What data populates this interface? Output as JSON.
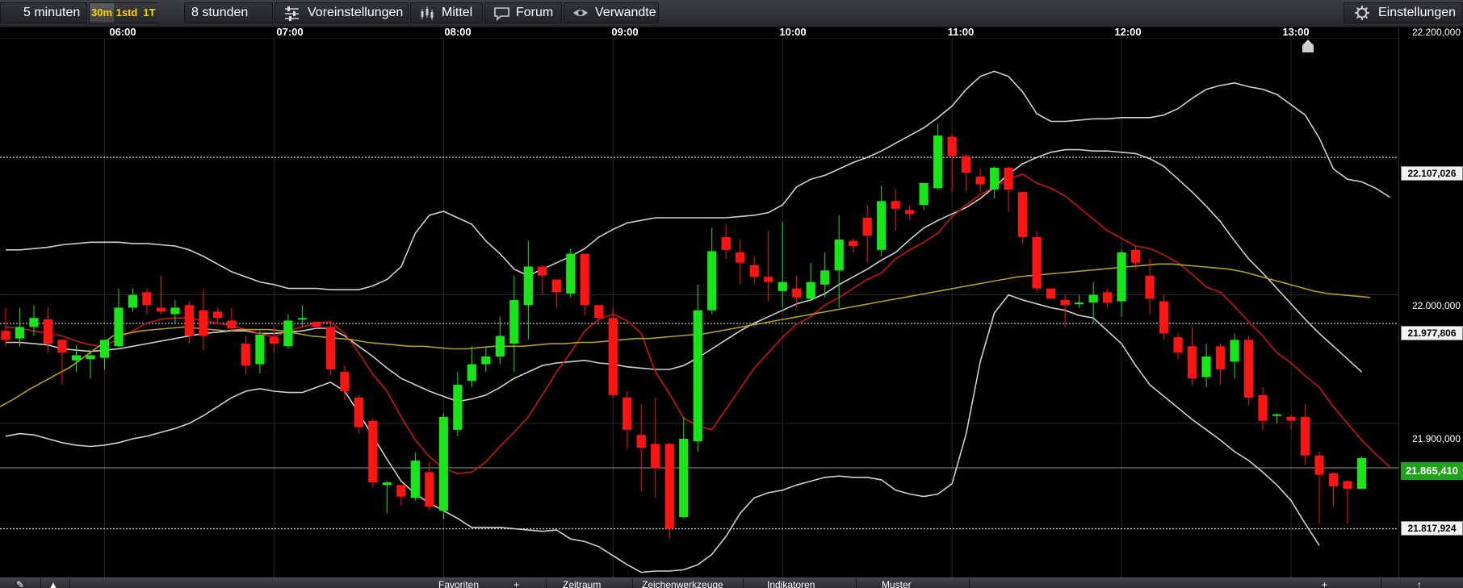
{
  "toolbar": {
    "interval": "5 minuten",
    "timeframes": [
      "30m",
      "1std",
      "1T"
    ],
    "period": "8 stunden",
    "presets": "Voreinstellungen",
    "average": "Mittel",
    "forum": "Forum",
    "related": "Verwandte",
    "settings": "Einstellungen"
  },
  "icons": {
    "presets": "sliders-icon",
    "average": "candles-icon",
    "forum": "chat-bubble-icon",
    "related": "eye-icon",
    "settings": "gear-icon"
  },
  "bottom_bar": {
    "tabs": [
      "Favoriten",
      "Zeitraum",
      "Zeichenwerkzeuge",
      "Indikatoren",
      "Muster"
    ]
  },
  "colors": {
    "bull": "#19e619",
    "bear": "#ff1414",
    "bollinger": "#d0d0d0",
    "ma_short": "#cc1414",
    "ma_long": "#b3a21e",
    "current_price": "#1fa319"
  },
  "chart_data": {
    "type": "candlestick",
    "x_ticks": [
      "06:00",
      "07:00",
      "08:00",
      "09:00",
      "10:00",
      "11:00",
      "12:00",
      "13:00"
    ],
    "y_ticks": [
      "22.200,000",
      "22.000,000",
      "21.900,000"
    ],
    "price_markers": [
      "22.107,026",
      "21.977,806",
      "21.817,924"
    ],
    "current_price": "21.865,410",
    "ylim": [
      21780,
      22200
    ],
    "xlim": [
      "05:23",
      "13:38"
    ],
    "candle_interval_minutes": 5,
    "first_candle_time": "05:25",
    "candles": [
      [
        21972,
        21965,
        21990,
        21960
      ],
      [
        21966,
        21975,
        21990,
        21960
      ],
      [
        21975,
        21982,
        21992,
        21968
      ],
      [
        21981,
        21962,
        21990,
        21955
      ],
      [
        21965,
        21955,
        21958,
        21930
      ],
      [
        21949,
        21953,
        21961,
        21940
      ],
      [
        21950,
        21953,
        21957,
        21935
      ],
      [
        21951,
        21965,
        21962,
        21942
      ],
      [
        21960,
        21990,
        22005,
        21959
      ],
      [
        21990,
        22000,
        22005,
        21987
      ],
      [
        22002,
        21992,
        22005,
        21985
      ],
      [
        21990,
        21987,
        22015,
        21985
      ],
      [
        21985,
        21990,
        21996,
        21978
      ],
      [
        21992,
        21968,
        21995,
        21962
      ],
      [
        21988,
        21968,
        22005,
        21957
      ],
      [
        21987,
        21982,
        21990,
        21978
      ],
      [
        21980,
        21974,
        21990,
        21972
      ],
      [
        21962,
        21945,
        21968,
        21938
      ],
      [
        21946,
        21969,
        21972,
        21939
      ],
      [
        21967,
        21962,
        21975,
        21955
      ],
      [
        21960,
        21980,
        21985,
        21958
      ],
      [
        21981,
        21982,
        21992,
        21975
      ],
      [
        21979,
        21975,
        21978,
        21974
      ],
      [
        21975,
        21942,
        21980,
        21937
      ],
      [
        21940,
        21925,
        21945,
        21918
      ],
      [
        21920,
        21897,
        21922,
        21892
      ],
      [
        21902,
        21854,
        21904,
        21850
      ],
      [
        21852,
        21854,
        21855,
        21830
      ],
      [
        21852,
        21843,
        21851,
        21836
      ],
      [
        21842,
        21871,
        21877,
        21840
      ],
      [
        21862,
        21835,
        21870,
        21832
      ],
      [
        21832,
        21905,
        21908,
        21825
      ],
      [
        21895,
        21930,
        21940,
        21890
      ],
      [
        21933,
        21946,
        21960,
        21928
      ],
      [
        21946,
        21952,
        21960,
        21940
      ],
      [
        21952,
        21968,
        21983,
        21946
      ],
      [
        21962,
        21996,
        22015,
        21940
      ],
      [
        21992,
        22022,
        22042,
        21965
      ],
      [
        22022,
        22015,
        22023,
        22000
      ],
      [
        22012,
        22002,
        22012,
        21990
      ],
      [
        22001,
        22032,
        22036,
        21998
      ],
      [
        22032,
        21992,
        22032,
        21984
      ],
      [
        21992,
        21982,
        21990,
        21979
      ],
      [
        21982,
        21922,
        21990,
        21920
      ],
      [
        21920,
        21895,
        21925,
        21880
      ],
      [
        21891,
        21881,
        21915,
        21847
      ],
      [
        21884,
        21865,
        21920,
        21842
      ],
      [
        21884,
        21818,
        21885,
        21810
      ],
      [
        21827,
        21888,
        21905,
        21826
      ],
      [
        21886,
        21988,
        22008,
        21878
      ],
      [
        21988,
        22034,
        22052,
        21985
      ],
      [
        22045,
        22035,
        22055,
        22028
      ],
      [
        22033,
        22025,
        22043,
        22008
      ],
      [
        22023,
        22014,
        22030,
        22008
      ],
      [
        22014,
        22010,
        22050,
        21995
      ],
      [
        22003,
        22010,
        22057,
        21990
      ],
      [
        22005,
        21998,
        22015,
        21990
      ],
      [
        21997,
        22010,
        22025,
        21995
      ],
      [
        22008,
        22019,
        22033,
        21998
      ],
      [
        22019,
        22043,
        22062,
        21990
      ],
      [
        22042,
        22038,
        22044,
        22033
      ],
      [
        22060,
        22046,
        22070,
        22025
      ],
      [
        22035,
        22073,
        22085,
        22030
      ],
      [
        22073,
        22067,
        22082,
        22050
      ],
      [
        22066,
        22063,
        22070,
        22058
      ],
      [
        22070,
        22087,
        22080,
        22066
      ],
      [
        22083,
        22124,
        22133,
        22082
      ],
      [
        22123,
        22108,
        22125,
        22080
      ],
      [
        22108,
        22095,
        22110,
        22080
      ],
      [
        22092,
        22086,
        22098,
        22080
      ],
      [
        22082,
        22099,
        22100,
        22075
      ],
      [
        22099,
        22082,
        22100,
        22065
      ],
      [
        22080,
        22045,
        22078,
        22040
      ],
      [
        22045,
        22005,
        22050,
        22002
      ],
      [
        22005,
        21997,
        22003,
        21998
      ],
      [
        21996,
        21992,
        22000,
        21975
      ],
      [
        21993,
        21994,
        22000,
        21990
      ],
      [
        21994,
        22000,
        22010,
        21978
      ],
      [
        22002,
        21994,
        22005,
        21990
      ],
      [
        21995,
        22033,
        22035,
        21983
      ],
      [
        22035,
        22025,
        22038,
        22020
      ],
      [
        22015,
        21997,
        22028,
        21985
      ],
      [
        21995,
        21970,
        22000,
        21965
      ],
      [
        21967,
        21955,
        21970,
        21950
      ],
      [
        21960,
        21935,
        21975,
        21930
      ],
      [
        21936,
        21952,
        21962,
        21928
      ],
      [
        21960,
        21942,
        21962,
        21930
      ],
      [
        21948,
        21965,
        21970,
        21935
      ],
      [
        21965,
        21920,
        21968,
        21915
      ],
      [
        21922,
        21902,
        21928,
        21895
      ],
      [
        21906,
        21907,
        21908,
        21900
      ],
      [
        21905,
        21902,
        21907,
        21895
      ],
      [
        21905,
        21875,
        21915,
        21868
      ],
      [
        21875,
        21860,
        21878,
        21822
      ],
      [
        21861,
        21851,
        21862,
        21836
      ],
      [
        21855,
        21849,
        21856,
        21822
      ],
      [
        21849,
        21873,
        21874,
        21849
      ]
    ],
    "series": [
      {
        "name": "Bollinger oben",
        "x_start": "05:25",
        "values": [
          22035,
          22035,
          22036,
          22037,
          22039,
          22040,
          22041,
          22041,
          22041,
          22040,
          22040,
          22039,
          22038,
          22035,
          22030,
          22024,
          22018,
          22014,
          22010,
          22008,
          22005,
          22005,
          22005,
          22004,
          22004,
          22004,
          22007,
          22012,
          22022,
          22048,
          22062,
          22065,
          22060,
          22055,
          22042,
          22032,
          22020,
          22015,
          22020,
          22025,
          22030,
          22036,
          22045,
          22051,
          22056,
          22058,
          22060,
          22060,
          22060,
          22060,
          22060,
          22060,
          22061,
          22062,
          22064,
          22070,
          22084,
          22090,
          22093,
          22098,
          22103,
          22107,
          22112,
          22118,
          22124,
          22130,
          22138,
          22147,
          22160,
          22170,
          22174,
          22170,
          22158,
          22141,
          22135,
          22135,
          22136,
          22137,
          22137,
          22138,
          22138,
          22138,
          22140,
          22145,
          22153,
          22160,
          22163,
          22165,
          22162,
          22160,
          22156,
          22148,
          22140,
          22122,
          22098,
          22090,
          22088,
          22083,
          22076
        ]
      },
      {
        "name": "Bollinger Mitte",
        "x_start": "05:25",
        "values": [
          21963,
          21963,
          21962,
          21961,
          21958,
          21957,
          21956,
          21957,
          21958,
          21960,
          21962,
          21964,
          21966,
          21968,
          21970,
          21971,
          21972,
          21972,
          21970,
          21970,
          21971,
          21972,
          21974,
          21974,
          21968,
          21960,
          21952,
          21943,
          21935,
          21930,
          21925,
          21921,
          21917,
          21919,
          21922,
          21928,
          21935,
          21940,
          21945,
          21947,
          21948,
          21949,
          21947,
          21946,
          21944,
          21943,
          21942,
          21942,
          21945,
          21951,
          21958,
          21965,
          21972,
          21978,
          21983,
          21988,
          21993,
          21996,
          22001,
          22008,
          22014,
          22020,
          22027,
          22033,
          22043,
          22052,
          22058,
          22063,
          22068,
          22075,
          22084,
          22094,
          22102,
          22107,
          22111,
          22113,
          22113,
          22112,
          22112,
          22111,
          22110,
          22106,
          22100,
          22090,
          22080,
          22069,
          22057,
          22042,
          22028,
          22017,
          22005,
          21993,
          21981,
          21970,
          21960,
          21950,
          21940
        ]
      },
      {
        "name": "Bollinger unten",
        "x_start": "05:25",
        "values": [
          21890,
          21892,
          21891,
          21888,
          21885,
          21883,
          21882,
          21883,
          21885,
          21888,
          21890,
          21893,
          21896,
          21900,
          21906,
          21913,
          21920,
          21925,
          21927,
          21925,
          21924,
          21924,
          21928,
          21932,
          21925,
          21908,
          21890,
          21872,
          21855,
          21845,
          21838,
          21832,
          21826,
          21819,
          21819,
          21819,
          21818,
          21817,
          21816,
          21817,
          21810,
          21808,
          21804,
          21797,
          21790,
          21784,
          21785,
          21785,
          21786,
          21790,
          21798,
          21812,
          21830,
          21842,
          21846,
          21848,
          21852,
          21855,
          21858,
          21859,
          21858,
          21858,
          21856,
          21848,
          21845,
          21843,
          21845,
          21853,
          21892,
          21948,
          21986,
          22000,
          21996,
          21993,
          21990,
          21988,
          21984,
          21982,
          21972,
          21962,
          21945,
          21930,
          21921,
          21912,
          21903,
          21895,
          21887,
          21878,
          21871,
          21862,
          21852,
          21840,
          21822,
          21805
        ]
      },
      {
        "name": "MA kurz",
        "x_start": "05:25",
        "values": [
          21975,
          21974,
          21972,
          21970,
          21968,
          21964,
          21961,
          21960,
          21966,
          21972,
          21978,
          21981,
          21982,
          21982,
          21980,
          21978,
          21976,
          21973,
          21970,
          21967,
          21972,
          21975,
          21978,
          21979,
          21970,
          21955,
          21938,
          21925,
          21905,
          21887,
          21874,
          21865,
          21861,
          21862,
          21870,
          21882,
          21893,
          21905,
          21922,
          21940,
          21955,
          21972,
          21981,
          21985,
          21980,
          21970,
          21940,
          21923,
          21904,
          21898,
          21895,
          21911,
          21927,
          21943,
          21955,
          21967,
          21977,
          21983,
          21992,
          21998,
          22005,
          22012,
          22017,
          22028,
          22035,
          22041,
          22048,
          22061,
          22070,
          22078,
          22084,
          22090,
          22094,
          22087,
          22083,
          22077,
          22068,
          22059,
          22050,
          22044,
          22038,
          22036,
          22031,
          22025,
          22016,
          22006,
          22002,
          21991,
          21979,
          21968,
          21955,
          21947,
          21937,
          21928,
          21913,
          21900,
          21887,
          21876,
          21866
        ]
      },
      {
        "name": "MA lang",
        "x_start": "05:23",
        "values": [
          21913,
          21919,
          21926,
          21932,
          21938,
          21944,
          21952,
          21960,
          21968,
          21970,
          21972,
          21973,
          21974,
          21975,
          21974,
          21973,
          21972,
          21973,
          21973,
          21973,
          21972,
          21970,
          21968,
          21967,
          21966,
          21965,
          21963,
          21962,
          21961,
          21960,
          21960,
          21959,
          21958,
          21958,
          21959,
          21960,
          21960,
          21960,
          21961,
          21962,
          21962,
          21963,
          21963,
          21964,
          21965,
          21966,
          21966,
          21967,
          21968,
          21969,
          21970,
          21972,
          21974,
          21976,
          21978,
          21980,
          21982,
          21984,
          21986,
          21988,
          21990,
          21992,
          21994,
          21996,
          21998,
          22000,
          22002,
          22004,
          22006,
          22008,
          22010,
          22012,
          22014,
          22015,
          22016,
          22017,
          22018,
          22019,
          22020,
          22021,
          22022,
          22023,
          22024,
          22024,
          22023,
          22022,
          22021,
          22020,
          22018,
          22015,
          22012,
          22009,
          22006,
          22003,
          22001,
          22000,
          21999,
          21998
        ]
      }
    ]
  }
}
